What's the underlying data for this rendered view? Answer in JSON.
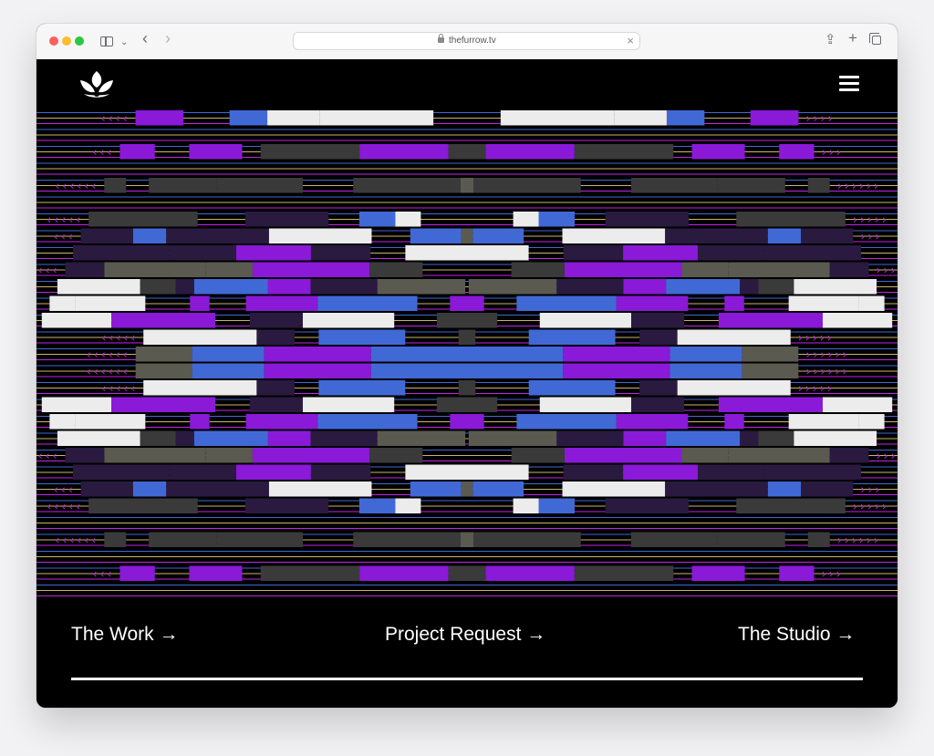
{
  "browser": {
    "url": "thefurrow.tv",
    "icons": [
      "sidebar-toggle-icon",
      "chevron-down-icon",
      "back-arrow-icon",
      "forward-arrow-icon",
      "lock-icon",
      "close-icon",
      "share-icon",
      "new-tab-icon",
      "tabs-overview-icon"
    ]
  },
  "site": {
    "logo_icon": "lotus-logo-icon",
    "menu_icon": "hamburger-menu-icon",
    "nav": {
      "work": "The Work →",
      "request": "Project Request →",
      "studio": "The Studio →"
    }
  },
  "colors": {
    "purple": "#8a19d8",
    "blue": "#4169d6",
    "grey": "#5a5a50",
    "white": "#ececec",
    "magenta_arrow": "#c225e8",
    "background": "#000000"
  }
}
